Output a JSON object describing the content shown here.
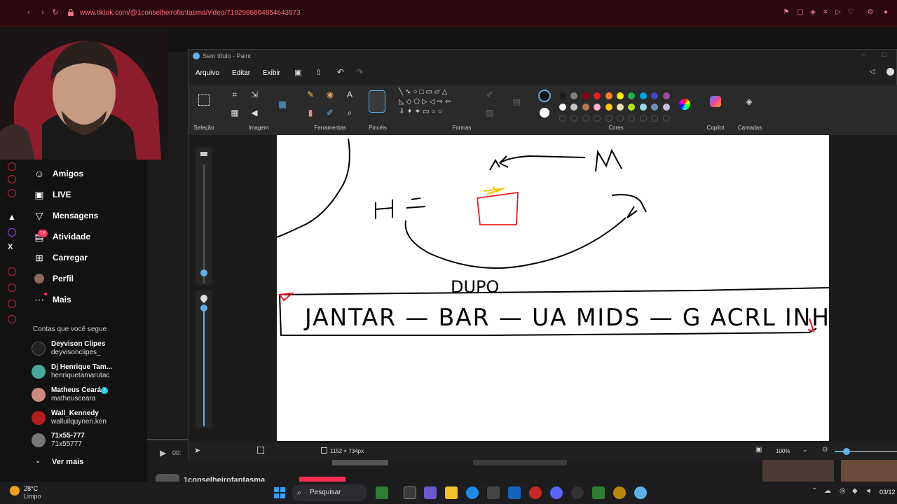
{
  "browser": {
    "url": "www.tiktok.com/@1conselheirofantasma/video/7192986604854643973"
  },
  "tiktok": {
    "nav": [
      {
        "label": "Amigos",
        "icon": "friends-icon"
      },
      {
        "label": "LIVE",
        "icon": "live-icon"
      },
      {
        "label": "Mensagens",
        "icon": "messages-icon"
      },
      {
        "label": "Atividade",
        "icon": "activity-icon",
        "badge": "18"
      },
      {
        "label": "Carregar",
        "icon": "upload-icon"
      },
      {
        "label": "Perfil",
        "icon": "profile-icon"
      },
      {
        "label": "Mais",
        "icon": "more-icon"
      }
    ],
    "following_heading": "Contas que você segue",
    "following": [
      {
        "name": "Deyvison Clipes",
        "handle": "deyvisonclipes_",
        "color": "#222222"
      },
      {
        "name": "Dj Henrique Tam...",
        "handle": "henriquetamarutac",
        "color": "#4aa89a"
      },
      {
        "name": "Matheus Ceará",
        "handle": "matheusceara",
        "color": "#cc8a80",
        "verified": true
      },
      {
        "name": "Wall_Kennedy",
        "handle": "walluilquynen.ken",
        "color": "#b02020"
      },
      {
        "name": "71x55-777",
        "handle": "71x55777",
        "color": "#777777"
      }
    ],
    "see_more": "Ver mais",
    "video_time": "00:",
    "bottom_username": "1conselheirofantasma"
  },
  "paint": {
    "title": "Sem título - Paint",
    "menus": [
      "Arquivo",
      "Editar",
      "Exibir"
    ],
    "groups": {
      "selection": "Seleção",
      "image": "Imagem",
      "tools": "Ferramentas",
      "brushes": "Pincéis",
      "shapes": "Formas",
      "colors": "Cores",
      "copilot": "Copilot",
      "layers": "Camadas"
    },
    "palette_row1": [
      "#1b1b1b",
      "#7f7f7f",
      "#880015",
      "#ed1c24",
      "#ff7f27",
      "#fff200",
      "#22b14c",
      "#00a2e8",
      "#3f48cc",
      "#a349a4"
    ],
    "palette_row2": [
      "#ffffff",
      "#c3c3c3",
      "#b97a57",
      "#ffaec9",
      "#ffc90e",
      "#efe4b0",
      "#b5e61d",
      "#99d9ea",
      "#7092be",
      "#c8bfe7"
    ],
    "canvas_size": "1152 × 734px",
    "zoom": "100%"
  },
  "drawing": {
    "top_letter": "M",
    "left_letter": "H",
    "under_label": "DUPO",
    "bottom_text": "JANTAR — BAR — UA MIDS — G ACRL INH"
  },
  "taskbar": {
    "temperature": "28°C",
    "weather": "Limpo",
    "search": "Pesquisar",
    "date": "03/12"
  }
}
